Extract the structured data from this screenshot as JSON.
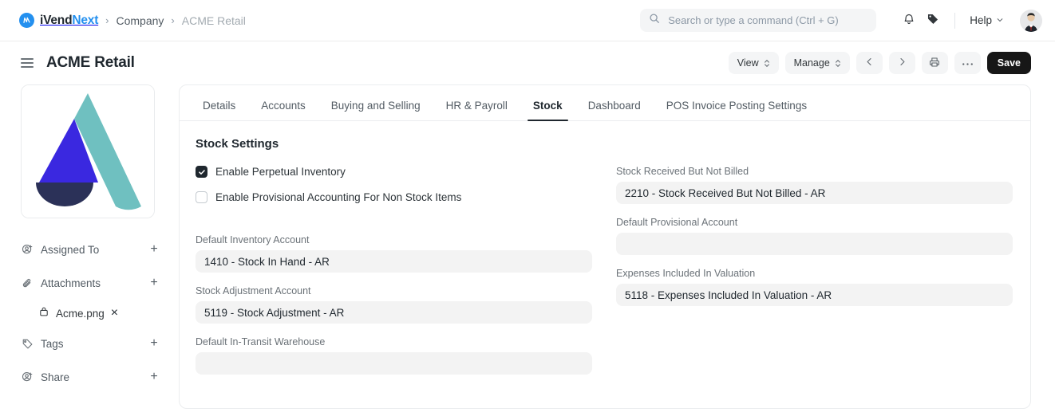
{
  "navbar": {
    "brand": {
      "prefix": "iVend",
      "suffix": "Next",
      "icon": "ivendnext-logo-icon"
    },
    "breadcrumbs": [
      {
        "label": "Company",
        "muted": false
      },
      {
        "label": "ACME Retail",
        "muted": true
      }
    ],
    "search": {
      "placeholder": "Search or type a command (Ctrl + G)",
      "value": "",
      "icon": "search-icon"
    },
    "notifications_icon": "bell-icon",
    "tag_icon": "tag-icon",
    "help": {
      "label": "Help",
      "chevron": "chevron-down-icon"
    },
    "avatar": "user-avatar"
  },
  "page_header": {
    "menu_icon": "hamburger-icon",
    "title": "ACME Retail",
    "actions": {
      "view": "View",
      "manage": "Manage",
      "prev_icon": "chevron-left-icon",
      "next_icon": "chevron-right-icon",
      "print_icon": "printer-icon",
      "more_icon": "ellipsis-icon",
      "save": "Save"
    }
  },
  "sidebar": {
    "logo_alt": "ACME Retail company logo",
    "logo_colors": {
      "teal": "#6fc0c0",
      "blue": "#3a28e0",
      "navy": "#2b3158"
    },
    "items": [
      {
        "label": "Assigned To",
        "icon": "user-plus-icon",
        "action": "add-icon",
        "action_glyph": "+"
      },
      {
        "label": "Attachments",
        "icon": "paperclip-icon",
        "action": "add-icon",
        "action_glyph": "+"
      },
      {
        "label": "Tags",
        "icon": "tag-outline-icon",
        "action": "add-icon",
        "action_glyph": "+"
      },
      {
        "label": "Share",
        "icon": "user-plus-icon",
        "action": "add-icon",
        "action_glyph": "+"
      }
    ],
    "attachment": {
      "label": "Acme.png",
      "icon": "file-icon",
      "action": "remove-icon",
      "action_glyph": "×"
    }
  },
  "main": {
    "tabs": [
      {
        "label": "Details",
        "active": false
      },
      {
        "label": "Accounts",
        "active": false
      },
      {
        "label": "Buying and Selling",
        "active": false
      },
      {
        "label": "HR & Payroll",
        "active": false
      },
      {
        "label": "Stock",
        "active": true
      },
      {
        "label": "Dashboard",
        "active": false
      },
      {
        "label": "POS Invoice Posting Settings",
        "active": false
      }
    ],
    "section_title": "Stock Settings",
    "checkboxes": [
      {
        "label": "Enable Perpetual Inventory",
        "checked": true
      },
      {
        "label": "Enable Provisional Accounting For Non Stock Items",
        "checked": false
      }
    ],
    "left_fields": [
      {
        "label": "Default Inventory Account",
        "value": "1410 - Stock In Hand - AR"
      },
      {
        "label": "Stock Adjustment Account",
        "value": "5119 - Stock Adjustment - AR"
      },
      {
        "label": "Default In-Transit Warehouse",
        "value": ""
      }
    ],
    "right_fields": [
      {
        "label": "Stock Received But Not Billed",
        "value": "2210 - Stock Received But Not Billed - AR"
      },
      {
        "label": "Default Provisional Account",
        "value": ""
      },
      {
        "label": "Expenses Included In Valuation",
        "value": "5118 - Expenses Included In Valuation - AR"
      }
    ]
  },
  "colors": {
    "accent": "#2490ef",
    "text": "#1f272e",
    "muted": "#6b7278",
    "field_bg": "#f3f3f3",
    "save_bg": "#171717"
  }
}
